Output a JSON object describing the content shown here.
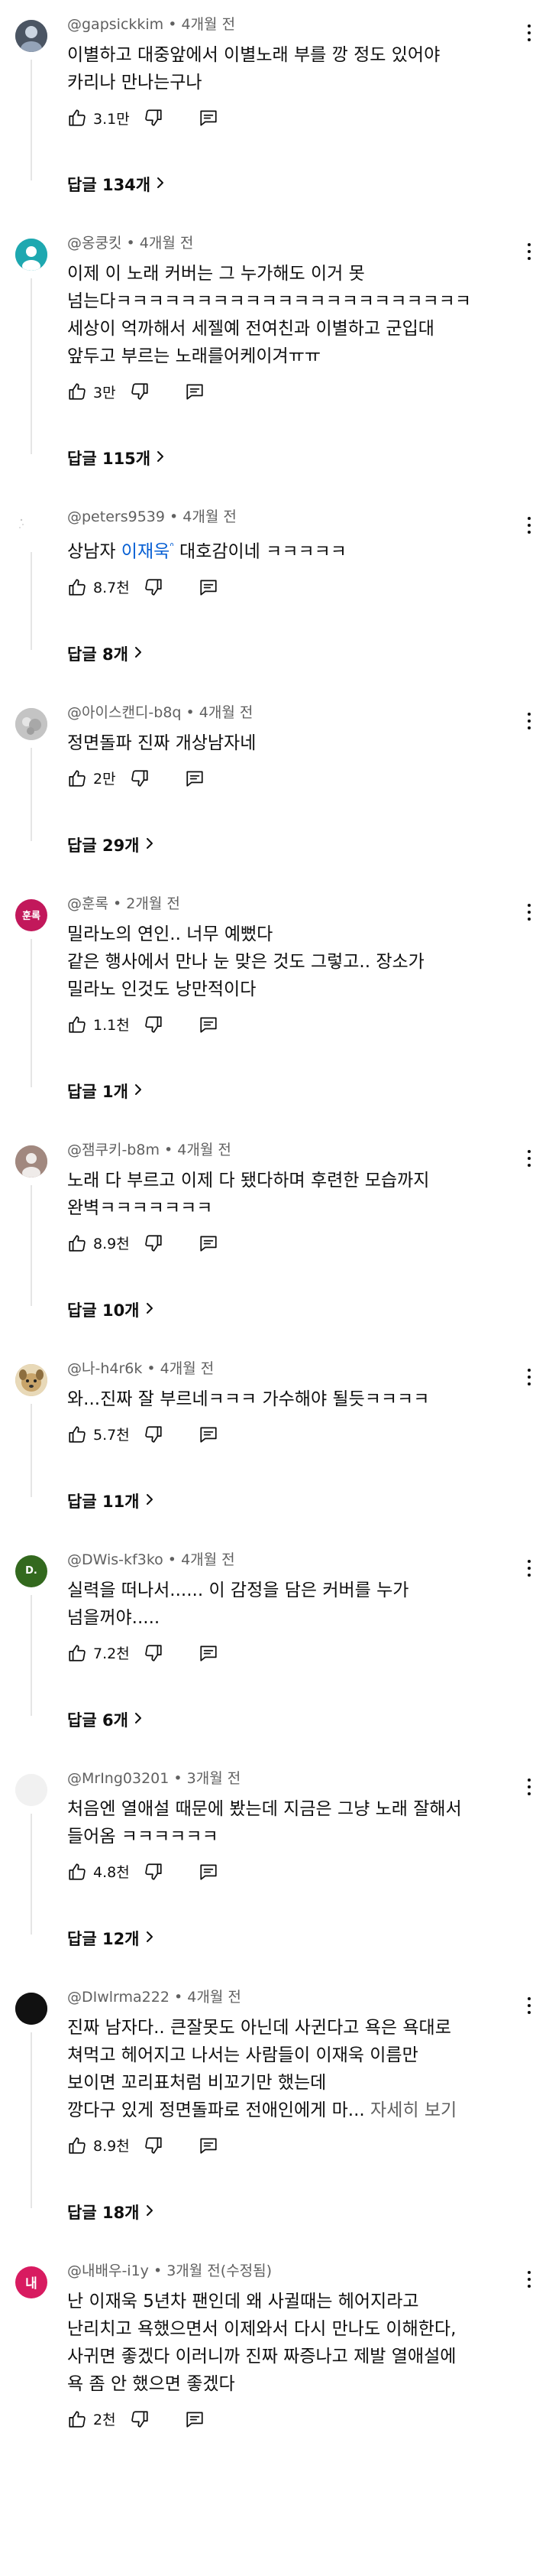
{
  "comments": [
    {
      "avatar": {
        "text": "",
        "color": "#5b6676",
        "kind": "photo-dark"
      },
      "author": "@gapsickkim",
      "time": "4개월 전",
      "lines": [
        "이별하고 대중앞에서 이별노래 부를 깡 정도 있어야",
        "카리나 만나는구나"
      ],
      "likes": "3.1만",
      "replies": "답글 134개"
    },
    {
      "avatar": {
        "text": "",
        "color": "#1ea8b0",
        "kind": "person-teal"
      },
      "author": "@옹쿵킷",
      "time": "4개월 전",
      "lines": [
        "이제 이 노래 커버는 그 누가해도 이거 못",
        "넘는다ㅋㅋㅋㅋㅋㅋㅋㅋㅋㅋㅋㅋㅋㅋㅋㅋㅋㅋㅋㅋㅋㅋ",
        "세상이 억까해서 세젤예 전여친과 이별하고 군입대",
        "앞두고 부르는 노래를어케이겨ㅠㅠ"
      ],
      "likes": "3만",
      "replies": "답글 115개"
    },
    {
      "avatar": {
        "text": "",
        "color": "#ffffff",
        "kind": "blank-dotted"
      },
      "author": "@peters9539",
      "time": "4개월 전",
      "lines": [
        "상남자 "
      ],
      "mention": "이재욱",
      "mention_suffix": "ᐢ",
      "after_mention": " 대호감이네 ㅋㅋㅋㅋㅋ",
      "likes": "8.7천",
      "replies": "답글 8개"
    },
    {
      "avatar": {
        "text": "",
        "color": "#b9b9b9",
        "kind": "photo-grey"
      },
      "author": "@아이스캔디-b8q",
      "time": "4개월 전",
      "lines": [
        "정면돌파 진짜 개상남자네"
      ],
      "likes": "2만",
      "replies": "답글 29개"
    },
    {
      "avatar": {
        "text": "훈록",
        "color": "#c2185b",
        "kind": "text"
      },
      "author": "@훈록",
      "time": "2개월 전",
      "lines": [
        "밀라노의 연인.. 너무 예뻤다",
        "같은 행사에서 만나 눈 맞은 것도 그렇고.. 장소가",
        "밀라노 인것도 낭만적이다"
      ],
      "likes": "1.1천",
      "replies": "답글 1개"
    },
    {
      "avatar": {
        "text": "",
        "color": "#a1887f",
        "kind": "person-brown"
      },
      "author": "@잼쿠키-b8m",
      "time": "4개월 전",
      "lines": [
        "노래 다 부르고 이제 다 됐다하며 후련한 모습까지",
        "완벽ㅋㅋㅋㅋㅋㅋㅋ"
      ],
      "likes": "8.9천",
      "replies": "답글 10개"
    },
    {
      "avatar": {
        "text": "",
        "color": "#c8a46a",
        "kind": "dog"
      },
      "author": "@나-h4r6k",
      "time": "4개월 전",
      "lines": [
        "와...진짜 잘 부르네ㅋㅋㅋ 가수해야 될듯ㅋㅋㅋㅋ"
      ],
      "likes": "5.7천",
      "replies": "답글 11개"
    },
    {
      "avatar": {
        "text": "D.",
        "color": "#33691e",
        "kind": "text"
      },
      "author": "@DWis-kf3ko",
      "time": "4개월 전",
      "lines": [
        "실력을 떠나서...... 이 감정을 담은 커버를 누가",
        "넘을꺼야....."
      ],
      "likes": "7.2천",
      "replies": "답글 6개"
    },
    {
      "avatar": {
        "text": "",
        "color": "#f1f1f1",
        "kind": "blank"
      },
      "author": "@MrIng03201",
      "time": "3개월 전",
      "lines": [
        "처음엔 열애설 때문에 봤는데 지금은 그냥 노래 잘해서",
        "들어옴 ㅋㅋㅋㅋㅋㅋ"
      ],
      "likes": "4.8천",
      "replies": "답글 12개"
    },
    {
      "avatar": {
        "text": "",
        "color": "#111111",
        "kind": "black"
      },
      "author": "@DIwlrma222",
      "time": "4개월 전",
      "lines": [
        "진짜 남자다.. 큰잘못도 아닌데 사귄다고 욕은 욕대로",
        "쳐먹고 헤어지고 나서는 사람들이 이재욱 이름만",
        "보이면 꼬리표처럼 비꼬기만 했는데",
        "깡다구 있게 정면돌파로 전애인에게 마..."
      ],
      "more": " 자세히 보기",
      "likes": "8.9천",
      "replies": "답글 18개"
    },
    {
      "avatar": {
        "text": "내",
        "color": "#d81b60",
        "kind": "text"
      },
      "author": "@내배우-i1y",
      "time": "3개월 전(수정됨)",
      "lines": [
        "난 이재욱 5년차 팬인데 왜 사귈때는 헤어지라고",
        "난리치고 욕했으면서 이제와서 다시 만나도 이해한다,",
        "사귀면 좋겠다 이러니까 진짜 짜증나고 제발 열애설에",
        "욕 좀 안 했으면 좋겠다"
      ],
      "likes": "2천",
      "replies": ""
    }
  ],
  "icons": {
    "like": "thumbs-up-icon",
    "dislike": "thumbs-down-icon",
    "reply": "reply-comment-icon",
    "more": "more-vert-icon",
    "chevron": "chevron-right-icon"
  },
  "colors": {
    "mention": "#065fd4",
    "meta": "#606060",
    "text": "#0f0f0f"
  }
}
